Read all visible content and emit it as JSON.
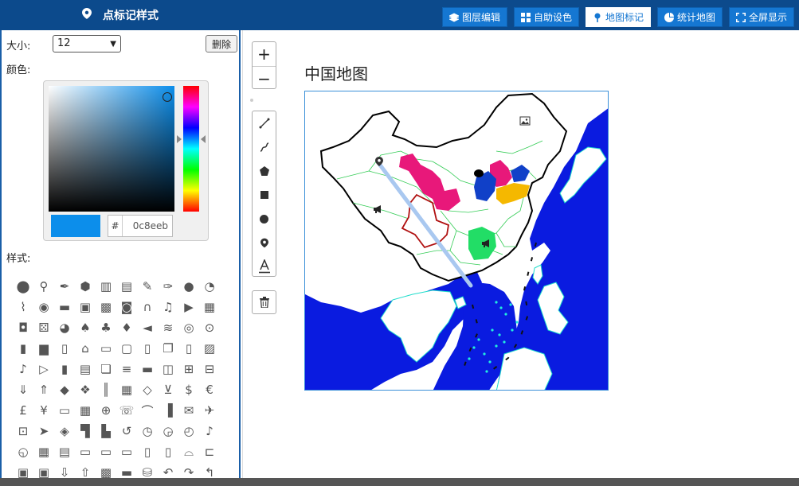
{
  "panel": {
    "title": "点标记样式"
  },
  "toolbar": {
    "buttons": [
      {
        "label": "图层编辑",
        "icon": "layers-icon"
      },
      {
        "label": "自助设色",
        "icon": "grid-icon"
      },
      {
        "label": "地图标记",
        "icon": "map-pin-icon",
        "active": true
      },
      {
        "label": "统计地图",
        "icon": "pie-chart-icon"
      },
      {
        "label": "全屏显示",
        "icon": "fullscreen-icon"
      }
    ]
  },
  "size": {
    "label": "大小:",
    "value": "12"
  },
  "delete_label": "删除",
  "color": {
    "label": "颜色:",
    "hex": "0c8eeb",
    "hash": "#",
    "value": "#0c8eeb"
  },
  "style_label": "样式:",
  "map": {
    "title": "中国地图"
  },
  "colors": {
    "topbar": "#0c4a8c",
    "button": "#1577d2",
    "ocean": "#0a1be0",
    "region_pink": "#e8187a",
    "region_blue": "#1040c8",
    "region_yellow": "#f5b800",
    "region_green": "#22dd66",
    "route": "#a9c8f0"
  }
}
